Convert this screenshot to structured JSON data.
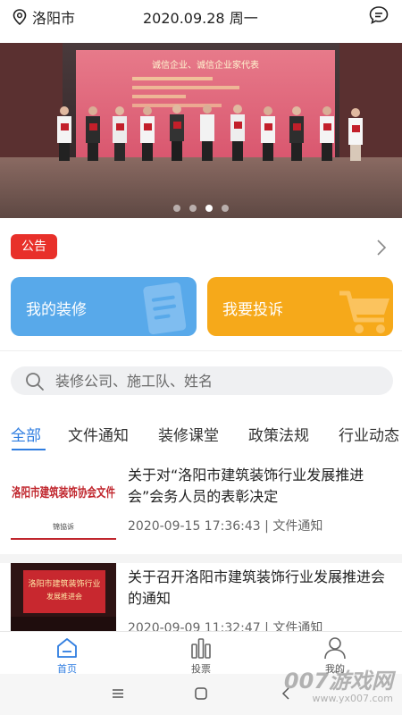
{
  "status": {
    "city": "洛阳市",
    "date": "2020.09.28 周一"
  },
  "banner": {
    "backdrop_line1": "诚信企业、诚信企业家代表",
    "slide_count": 4,
    "active_slide": 3
  },
  "notice": {
    "tag": "公告"
  },
  "quick_actions": [
    {
      "label": "我的装修",
      "color": "#58a9ea"
    },
    {
      "label": "我要投诉",
      "color": "#f6a91a"
    }
  ],
  "search": {
    "placeholder": "装修公司、施工队、姓名"
  },
  "tabs": [
    {
      "label": "全部",
      "active": true
    },
    {
      "label": "文件通知",
      "active": false
    },
    {
      "label": "装修课堂",
      "active": false
    },
    {
      "label": "政策法规",
      "active": false
    },
    {
      "label": "行业动态",
      "active": false
    }
  ],
  "news": [
    {
      "title": "关于对“洛阳市建筑装饰行业发展推进会”会务人员的表彰决定",
      "datetime": "2020-09-15 17:36:43",
      "category": "文件通知",
      "thumb_text": "洛阳市建筑装饰协会文件",
      "thumb_sub": "锦協诉"
    },
    {
      "title": "关于召开洛阳市建筑装饰行业发展推进会的通知",
      "datetime": "2020-09-09 11:32:47",
      "category": "文件通知",
      "thumb_text": "洛阳市建筑装饰行业",
      "thumb_sub": "发展推进会"
    }
  ],
  "bottom_nav": [
    {
      "label": "首页",
      "icon": "home-icon",
      "active": true
    },
    {
      "label": "投票",
      "icon": "vote-icon",
      "active": false
    },
    {
      "label": "我的",
      "icon": "user-icon",
      "active": false
    }
  ],
  "watermark": {
    "line1": "007游戏网",
    "line2": "www.yx007.com"
  },
  "colors": {
    "accent": "#2f7de0",
    "notice_red": "#e8302a"
  }
}
